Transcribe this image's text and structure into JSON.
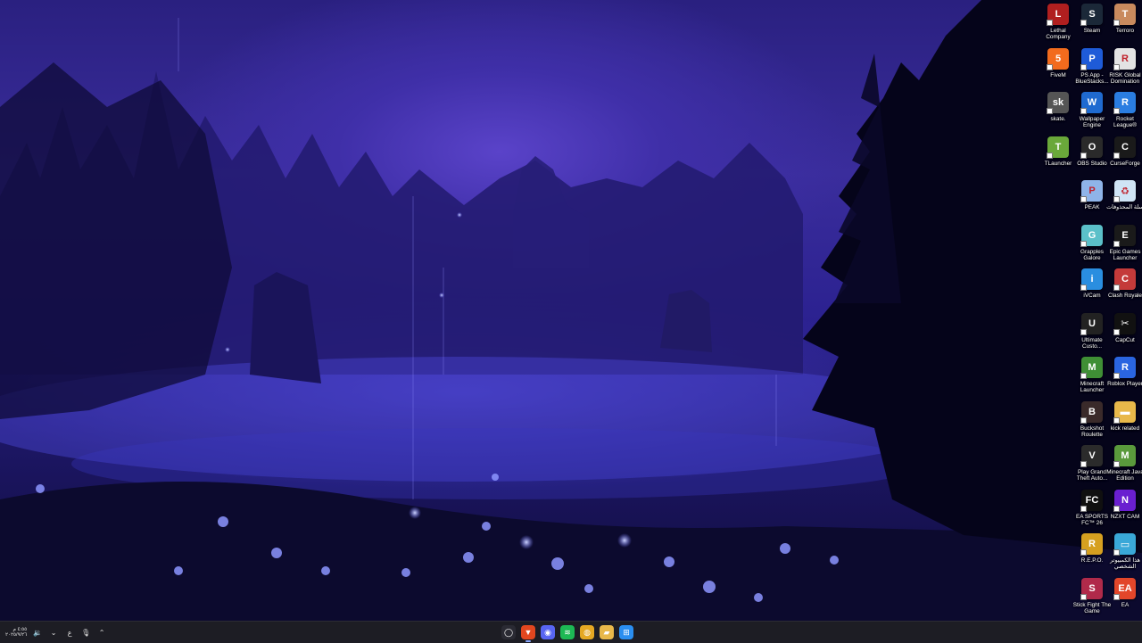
{
  "desktop": {
    "icons": [
      {
        "label": "Lethal Company",
        "icon": "lethal-company-icon",
        "color": "#b01f1f",
        "glyph": "L"
      },
      {
        "label": "Steam",
        "icon": "steam-icon",
        "color": "#1b2838",
        "glyph": "S"
      },
      {
        "label": "Terroro",
        "icon": "terroro-icon",
        "color": "#c98a5e",
        "glyph": "T"
      },
      {
        "label": "FiveM",
        "icon": "fivem-icon",
        "color": "#f26b1d",
        "glyph": "5"
      },
      {
        "label": "PS App - BlueStacks...",
        "icon": "ps-app-icon",
        "color": "#1e5bd8",
        "glyph": "P"
      },
      {
        "label": "RISK Global Domination",
        "icon": "risk-icon",
        "color": "#e3e3e3",
        "glyph": "R"
      },
      {
        "label": "skate.",
        "icon": "skate-icon",
        "color": "#555555",
        "glyph": "sk"
      },
      {
        "label": "Wallpaper Engine",
        "icon": "wallpaper-engine-icon",
        "color": "#1f6ad0",
        "glyph": "W"
      },
      {
        "label": "Rocket League®",
        "icon": "rocket-league-icon",
        "color": "#2a7de1",
        "glyph": "R"
      },
      {
        "label": "TLauncher",
        "icon": "tlauncher-icon",
        "color": "#6aa83a",
        "glyph": "T"
      },
      {
        "label": "OBS Studio",
        "icon": "obs-icon",
        "color": "#2a2a2a",
        "glyph": "O"
      },
      {
        "label": "CurseForge",
        "icon": "curseforge-icon",
        "color": "#1a1a1a",
        "glyph": "C"
      },
      {
        "label": "PEAK",
        "icon": "peak-icon",
        "color": "#8fb4e8",
        "glyph": "P"
      },
      {
        "label": "سلة المحذوفات",
        "icon": "recycle-bin-icon",
        "color": "#cfe4f5",
        "glyph": "♻"
      },
      {
        "label": "Grapples Galore",
        "icon": "grapples-galore-icon",
        "color": "#5bc0c9",
        "glyph": "G"
      },
      {
        "label": "Epic Games Launcher",
        "icon": "epic-games-icon",
        "color": "#1a1a1a",
        "glyph": "E"
      },
      {
        "label": "iVCam",
        "icon": "ivcam-icon",
        "color": "#2a8ee0",
        "glyph": "i"
      },
      {
        "label": "Clash Royale",
        "icon": "clash-royale-icon",
        "color": "#c43a3a",
        "glyph": "C"
      },
      {
        "label": "Ultimate Custo...",
        "icon": "ultimate-custom-night-icon",
        "color": "#222222",
        "glyph": "U"
      },
      {
        "label": "CapCut",
        "icon": "capcut-icon",
        "color": "#111111",
        "glyph": "✂"
      },
      {
        "label": "Minecraft Launcher",
        "icon": "minecraft-launcher-icon",
        "color": "#3f8f35",
        "glyph": "M"
      },
      {
        "label": "Roblox Player",
        "icon": "roblox-icon",
        "color": "#2a65e0",
        "glyph": "R"
      },
      {
        "label": "Buckshot Roulette",
        "icon": "buckshot-roulette-icon",
        "color": "#3a2a2a",
        "glyph": "B"
      },
      {
        "label": "kick related",
        "icon": "folder-icon",
        "color": "#e8b84a",
        "glyph": "▬"
      },
      {
        "label": "Play Grand Theft Auto...",
        "icon": "gta-icon",
        "color": "#2b2b2b",
        "glyph": "V"
      },
      {
        "label": "Minecraft Java Edition",
        "icon": "minecraft-java-icon",
        "color": "#5a9a3c",
        "glyph": "M"
      },
      {
        "label": "EA SPORTS FC™ 26",
        "icon": "ea-sports-fc-icon",
        "color": "#101010",
        "glyph": "FC"
      },
      {
        "label": "NZXT CAM",
        "icon": "nzxt-cam-icon",
        "color": "#6a1fd0",
        "glyph": "N"
      },
      {
        "label": "R.E.P.O.",
        "icon": "repo-icon",
        "color": "#d6a020",
        "glyph": "R"
      },
      {
        "label": "هذا الكمبيوتر الشخصي",
        "icon": "this-pc-icon",
        "color": "#3aa8d8",
        "glyph": "▭"
      },
      {
        "label": "Stick Fight The Game",
        "icon": "stick-fight-icon",
        "color": "#b02a4a",
        "glyph": "S"
      },
      {
        "label": "EA",
        "icon": "ea-icon",
        "color": "#e2462a",
        "glyph": "EA"
      }
    ]
  },
  "taskbar": {
    "clock_time": "٤:٥٥ م",
    "clock_date": "٢٠٢٥/٩/٢٦",
    "language": "ع",
    "tray_icons": [
      "network-icon",
      "volume-icon",
      "chevron-down-icon",
      "microphone-icon",
      "chevron-up-icon"
    ],
    "apps": [
      {
        "name": "cortana-icon",
        "glyph": "◯",
        "color": "#2a2a33"
      },
      {
        "name": "brave-icon",
        "glyph": "▼",
        "color": "#e2471f"
      },
      {
        "name": "discord-icon",
        "glyph": "◉",
        "color": "#5865f2"
      },
      {
        "name": "spotify-icon",
        "glyph": "≋",
        "color": "#1db954"
      },
      {
        "name": "chrome-icon",
        "glyph": "◍",
        "color": "#e5a823"
      },
      {
        "name": "file-explorer-icon",
        "glyph": "▰",
        "color": "#e8b84a"
      },
      {
        "name": "windows-start-icon",
        "glyph": "⊞",
        "color": "#2a8ef0"
      }
    ]
  }
}
